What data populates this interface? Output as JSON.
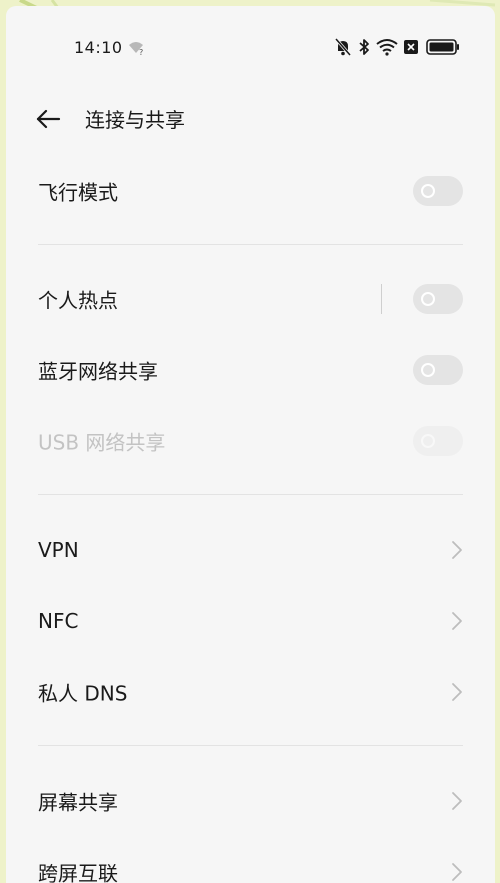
{
  "status_bar": {
    "time": "14:10",
    "icons": [
      "wifi-unknown-icon",
      "mute-bell-icon",
      "bluetooth-icon",
      "wifi-icon",
      "no-sim-icon",
      "battery-icon"
    ]
  },
  "header": {
    "back_icon": "arrow-left-icon",
    "title": "连接与共享"
  },
  "settings": {
    "airplane": {
      "label": "飞行模式",
      "enabled": false
    },
    "hotspot": {
      "label": "个人热点",
      "enabled": false
    },
    "bt_tether": {
      "label": "蓝牙网络共享",
      "enabled": false
    },
    "usb_tether": {
      "label": "USB 网络共享",
      "enabled": false,
      "disabled": true
    },
    "vpn": {
      "label": "VPN"
    },
    "nfc": {
      "label": "NFC"
    },
    "private_dns": {
      "label": "私人 DNS"
    },
    "screen_share": {
      "label": "屏幕共享"
    },
    "cross_screen": {
      "label": "跨屏互联"
    }
  },
  "colors": {
    "background_border": "#eef2c9",
    "page": "#f6f6f6",
    "text": "#1a1a1a",
    "disabled_text": "#c3c3c3",
    "toggle_off": "#e4e4e4"
  }
}
